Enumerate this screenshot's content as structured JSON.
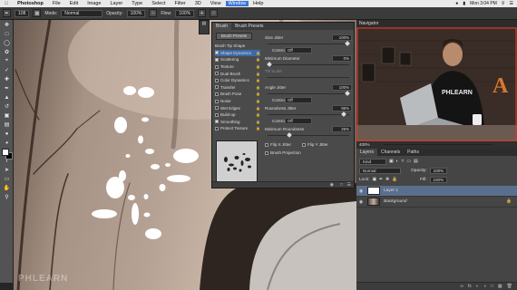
{
  "menubar": {
    "app": "Photoshop",
    "items": [
      "File",
      "Edit",
      "Image",
      "Layer",
      "Type",
      "Select",
      "Filter",
      "3D",
      "View",
      "Window",
      "Help"
    ],
    "highlighted": "Window",
    "clock": "Mon 3:04 PM"
  },
  "options": {
    "brush_size": "108",
    "mode_label": "Mode:",
    "mode_value": "Normal",
    "opacity_label": "Opacity:",
    "opacity_value": "100%",
    "flow_label": "Flow:",
    "flow_value": "100%"
  },
  "brush_panel": {
    "tabs": [
      "Brush",
      "Brush Presets"
    ],
    "presets_button": "Brush Presets",
    "list": [
      {
        "label": "Brush Tip Shape",
        "checkbox": false,
        "checked": false,
        "selected": false
      },
      {
        "label": "Shape Dynamics",
        "checkbox": true,
        "checked": true,
        "selected": true
      },
      {
        "label": "Scattering",
        "checkbox": true,
        "checked": true,
        "selected": false
      },
      {
        "label": "Texture",
        "checkbox": true,
        "checked": false,
        "selected": false
      },
      {
        "label": "Dual Brush",
        "checkbox": true,
        "checked": false,
        "selected": false
      },
      {
        "label": "Color Dynamics",
        "checkbox": true,
        "checked": false,
        "selected": false
      },
      {
        "label": "Transfer",
        "checkbox": true,
        "checked": false,
        "selected": false
      },
      {
        "label": "Brush Pose",
        "checkbox": true,
        "checked": false,
        "selected": false
      },
      {
        "label": "Noise",
        "checkbox": true,
        "checked": false,
        "selected": false
      },
      {
        "label": "Wet Edges",
        "checkbox": true,
        "checked": false,
        "selected": false
      },
      {
        "label": "Build-up",
        "checkbox": true,
        "checked": false,
        "selected": false
      },
      {
        "label": "Smoothing",
        "checkbox": true,
        "checked": true,
        "selected": false
      },
      {
        "label": "Protect Texture",
        "checkbox": true,
        "checked": false,
        "selected": false
      }
    ],
    "size_jitter_label": "Size Jitter",
    "size_jitter_value": "100%",
    "size_jitter_fraction": 1.0,
    "control_label": "Control:",
    "control_value": "Off",
    "min_diameter_label": "Minimum Diameter",
    "min_diameter_value": "0%",
    "min_diameter_fraction": 0.0,
    "tilt_scale_label": "Tilt Scale",
    "angle_jitter_label": "Angle Jitter",
    "angle_jitter_value": "100%",
    "angle_jitter_fraction": 1.0,
    "angle_control_value": "Off",
    "roundness_jitter_label": "Roundness Jitter",
    "roundness_jitter_value": "95%",
    "roundness_jitter_fraction": 0.95,
    "roundness_control_value": "Off",
    "min_roundness_label": "Minimum Roundness",
    "min_roundness_value": "25%",
    "min_roundness_fraction": 0.25,
    "flip_x_label": "Flip X Jitter",
    "flip_y_label": "Flip Y Jitter",
    "projection_label": "Brush Projection"
  },
  "navigator": {
    "title": "Navigator",
    "zoom": "400%",
    "sign_text": "PHLEARN",
    "marquee_letter": "A"
  },
  "layers": {
    "tabs": [
      "Layers",
      "Channels",
      "Paths"
    ],
    "kind_label": "Kind",
    "blend_mode": "Normal",
    "opacity_label": "Opacity:",
    "opacity_value": "100%",
    "lock_label": "Lock:",
    "fill_label": "Fill:",
    "fill_value": "100%",
    "items": [
      {
        "name": "Layer 1",
        "selected": true
      },
      {
        "name": "Background",
        "selected": false
      }
    ]
  },
  "watermark": "PHLEARN",
  "colors": {
    "foreground": "#ffffff",
    "background": "#000000",
    "selection": "#3c6aa8"
  }
}
